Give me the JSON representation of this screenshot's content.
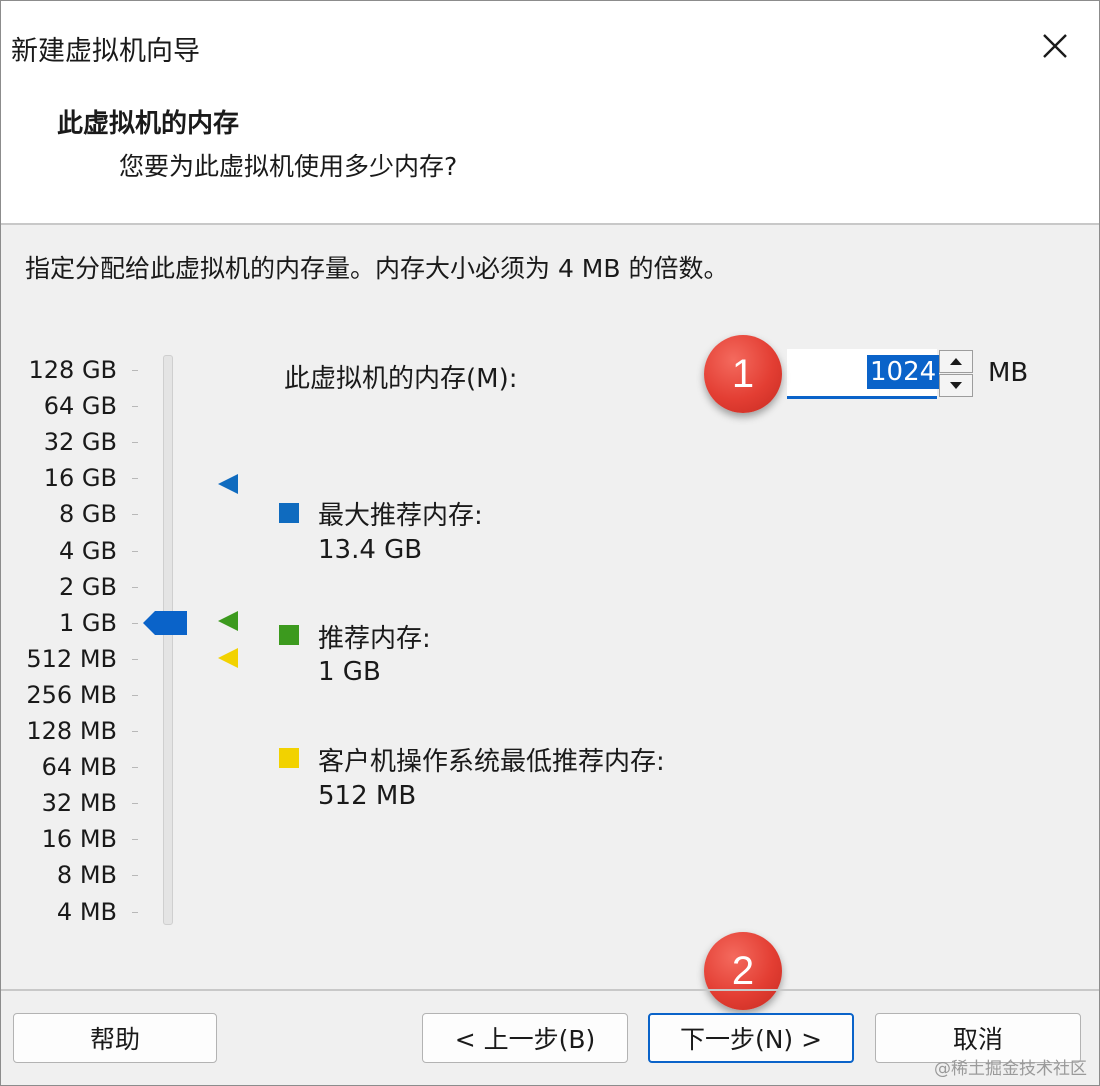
{
  "window": {
    "title": "新建虚拟机向导"
  },
  "header": {
    "title": "此虚拟机的内存",
    "subtitle": "您要为此虚拟机使用多少内存?"
  },
  "instruction": "指定分配给此虚拟机的内存量。内存大小必须为 4 MB 的倍数。",
  "scale": {
    "labels": [
      "128 GB",
      "64 GB",
      "32 GB",
      "16 GB",
      "8 GB",
      "4 GB",
      "2 GB",
      "1 GB",
      "512 MB",
      "256 MB",
      "128 MB",
      "64 MB",
      "32 MB",
      "16 MB",
      "8 MB",
      "4 MB"
    ],
    "selected": "1 GB"
  },
  "memory": {
    "label": "此虚拟机的内存(M):",
    "value": "1024",
    "unit": "MB"
  },
  "legend": {
    "max": {
      "label": "最大推荐内存:",
      "value": "13.4 GB",
      "color": "#0f6bbf"
    },
    "recommended": {
      "label": "推荐内存:",
      "value": "1 GB",
      "color": "#3c9a1e"
    },
    "minimum": {
      "label": "客户机操作系统最低推荐内存:",
      "value": "512 MB",
      "color": "#f2d200"
    }
  },
  "colors": {
    "accent": "#0a63c9",
    "badge": "#e33e33"
  },
  "badges": {
    "first": "1",
    "second": "2"
  },
  "buttons": {
    "help": "帮助",
    "back": "< 上一步(B)",
    "next": "下一步(N) >",
    "cancel": "取消"
  },
  "watermark": "@稀土掘金技术社区"
}
